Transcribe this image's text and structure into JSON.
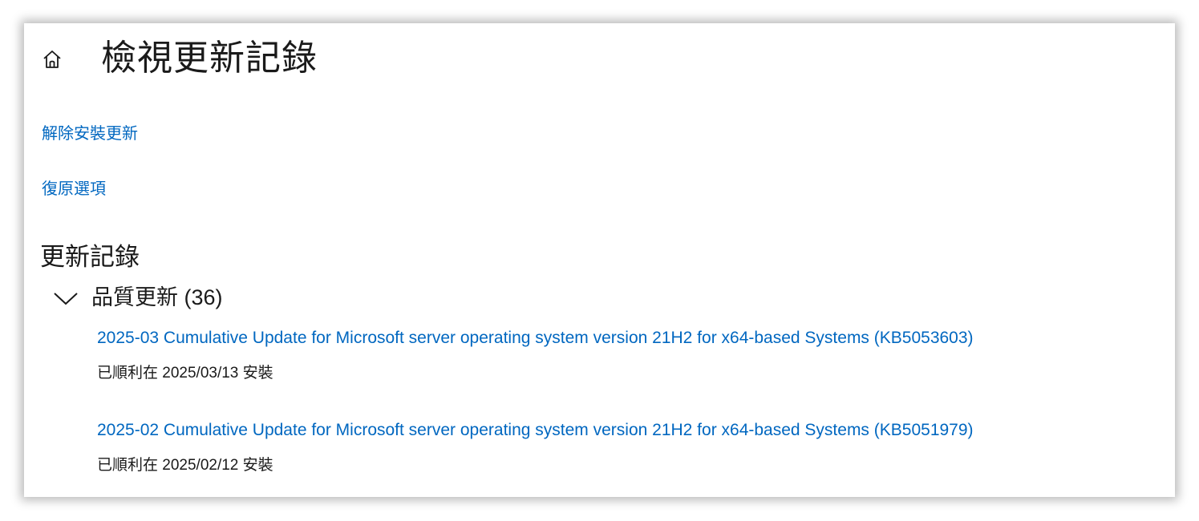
{
  "header": {
    "home_icon": "home-icon",
    "title": "檢視更新記錄"
  },
  "links": {
    "uninstall": "解除安裝更新",
    "recovery": "復原選項"
  },
  "section": {
    "title": "更新記錄"
  },
  "group": {
    "chevron_icon": "chevron-down-icon",
    "label": "品質更新 (36)"
  },
  "updates": [
    {
      "title": "2025-03 Cumulative Update for Microsoft server operating system version 21H2 for x64-based Systems (KB5053603)",
      "status": "已順利在 2025/03/13 安裝"
    },
    {
      "title": "2025-02 Cumulative Update for Microsoft server operating system version 21H2 for x64-based Systems (KB5051979)",
      "status": "已順利在 2025/02/12 安裝"
    }
  ],
  "colors": {
    "link": "#0067c0",
    "text": "#1a1a1a",
    "background": "#ffffff"
  }
}
